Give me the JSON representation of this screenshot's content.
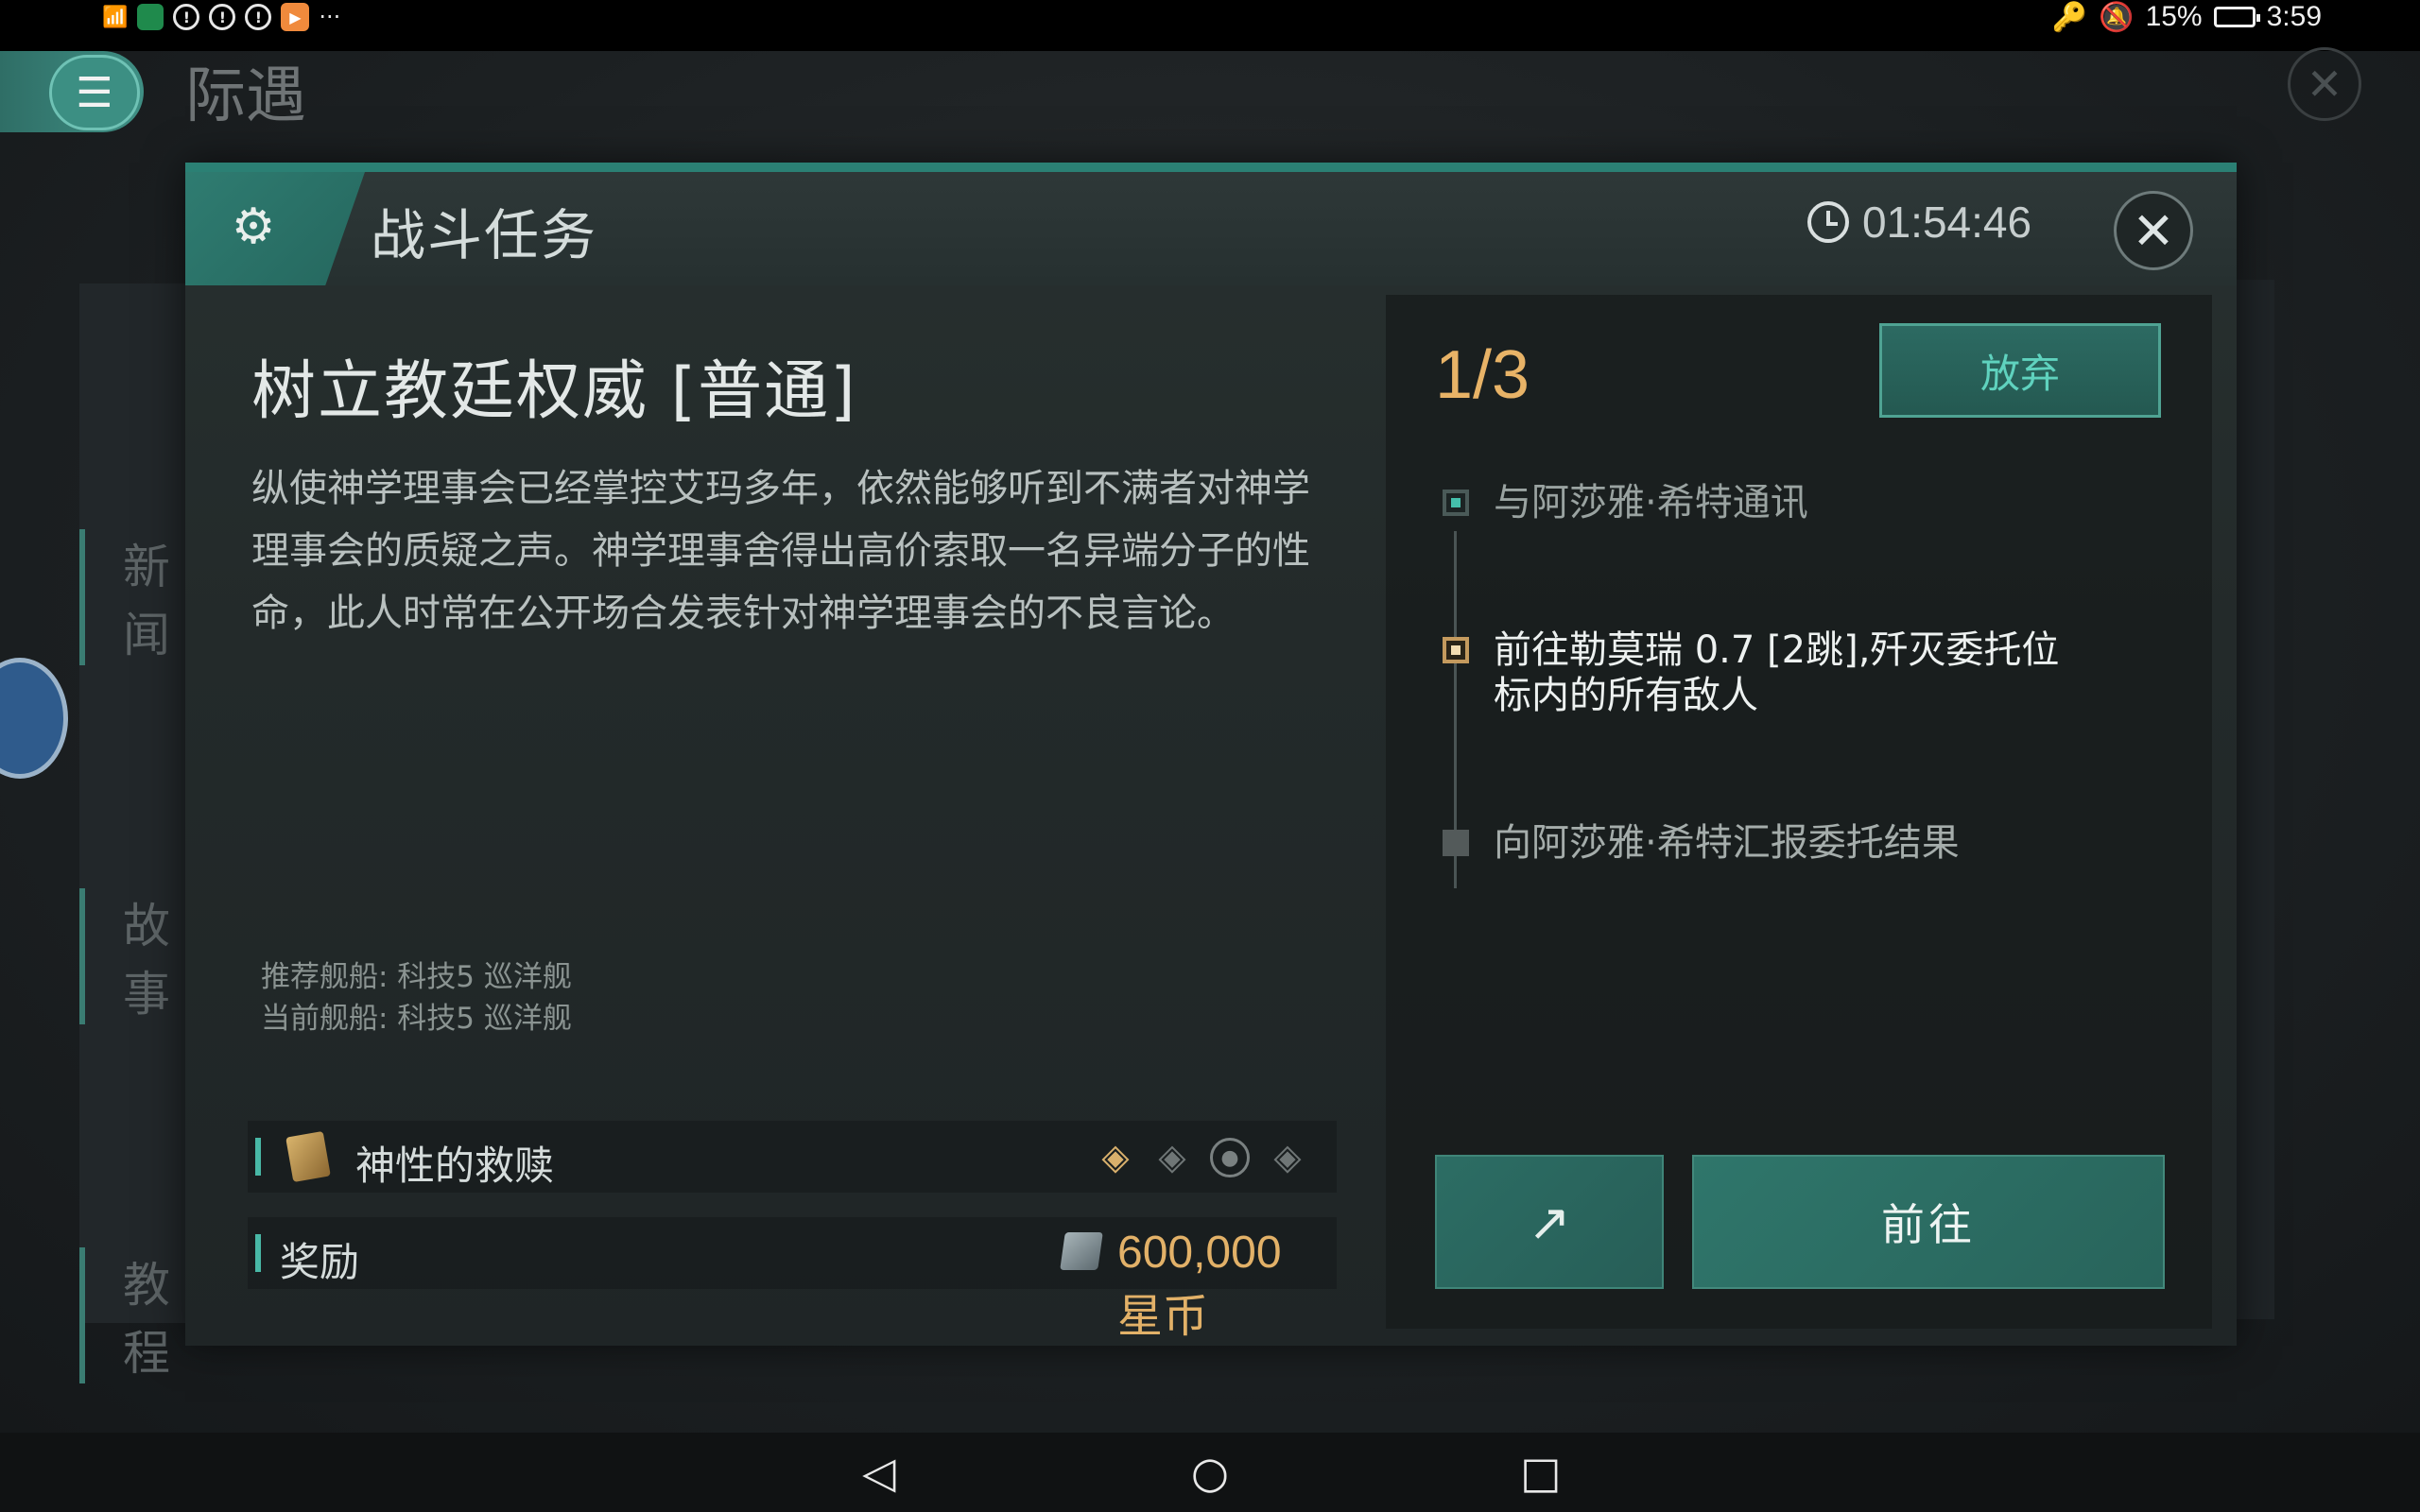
{
  "status_bar": {
    "time": "3:59",
    "battery": "15%",
    "icons": [
      "wifi-icon",
      "app-icon",
      "alert-icon",
      "alert-icon",
      "alert-icon",
      "app-icon",
      "more-icon"
    ],
    "right_icons": [
      "key-icon",
      "mute-icon",
      "battery-icon"
    ]
  },
  "background": {
    "title": "际遇",
    "sidebar_items": [
      "新闻",
      "故事",
      "教程"
    ]
  },
  "dialog": {
    "title": "战斗任务",
    "timer": "01:54:46",
    "mission_title": "树立教廷权威 [普通]",
    "description": "纵使神学理事会已经掌控艾玛多年，依然能够听到不满者对神学理事会的质疑之声。神学理事舍得出高价索取一名异端分子的性命，此人时常在公开场合发表针对神学理事会的不良言论。",
    "recommended_ship": "推荐舰船: 科技5 巡洋舰",
    "current_ship": "当前舰船: 科技5 巡洋舰",
    "item": {
      "name": "神性的救赎",
      "difficulty_icons": [
        "diamond-active",
        "diamond",
        "circle",
        "diamond"
      ]
    },
    "reward": {
      "label": "奖励",
      "value": "600,000 星币"
    },
    "progress": "1/3",
    "abandon_label": "放弃",
    "steps": [
      {
        "text": "与阿莎雅·希特通讯",
        "state": "done"
      },
      {
        "text": "前往勒莫瑞 0.7 [2跳],歼灭委托位标内的所有敌人",
        "state": "current"
      },
      {
        "text": "向阿莎雅·希特汇报委托结果",
        "state": "todo"
      }
    ],
    "go_label": "前往"
  },
  "colors": {
    "accent": "#2b8074",
    "gold": "#e8b367",
    "teal_text": "#5fd2be"
  }
}
